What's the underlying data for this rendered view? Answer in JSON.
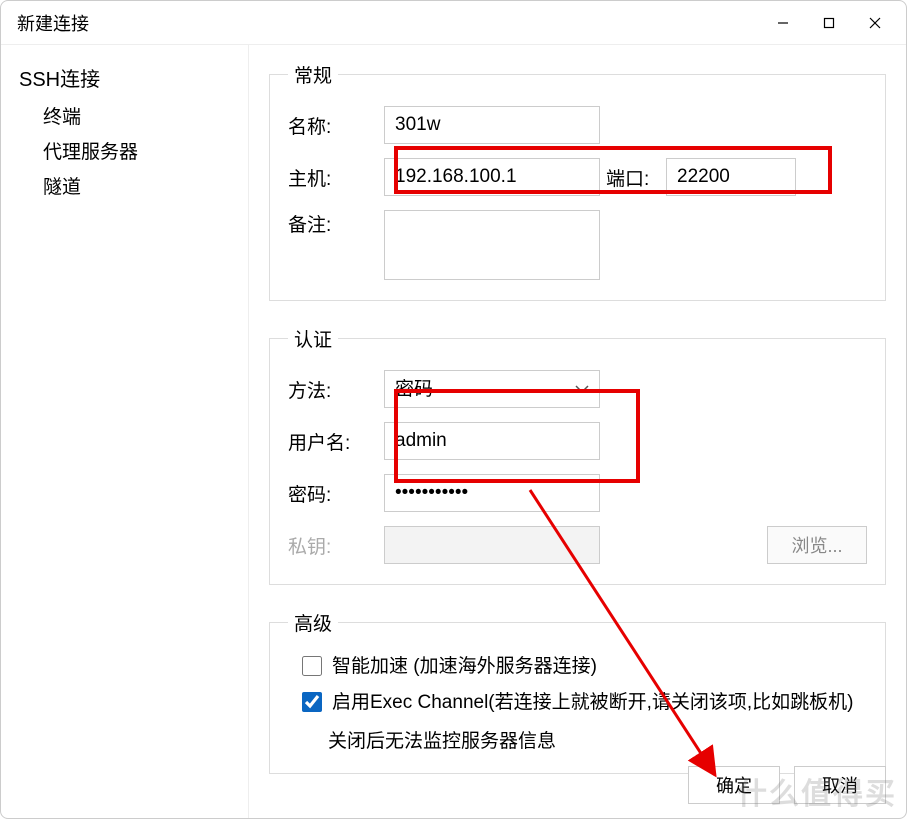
{
  "window": {
    "title": "新建连接"
  },
  "sidebar": {
    "root": "SSH连接",
    "items": [
      "终端",
      "代理服务器",
      "隧道"
    ]
  },
  "general": {
    "legend": "常规",
    "name_label": "名称:",
    "name_value": "301w",
    "host_label": "主机:",
    "host_value": "192.168.100.1",
    "port_label": "端口:",
    "port_value": "22200",
    "notes_label": "备注:",
    "notes_value": ""
  },
  "auth": {
    "legend": "认证",
    "method_label": "方法:",
    "method_value": "密码",
    "user_label": "用户名:",
    "user_value": "admin",
    "pass_label": "密码:",
    "pass_value": "•••••••••••",
    "key_label": "私钥:",
    "key_value": "",
    "browse_label": "浏览..."
  },
  "advanced": {
    "legend": "高级",
    "smart_label": "智能加速 (加速海外服务器连接)",
    "smart_checked": false,
    "exec_label": "启用Exec Channel(若连接上就被断开,请关闭该项,比如跳板机)",
    "exec_checked": true,
    "exec_note": "关闭后无法监控服务器信息"
  },
  "footer": {
    "ok": "确定",
    "cancel": "取消"
  },
  "watermark": "什么值得买"
}
